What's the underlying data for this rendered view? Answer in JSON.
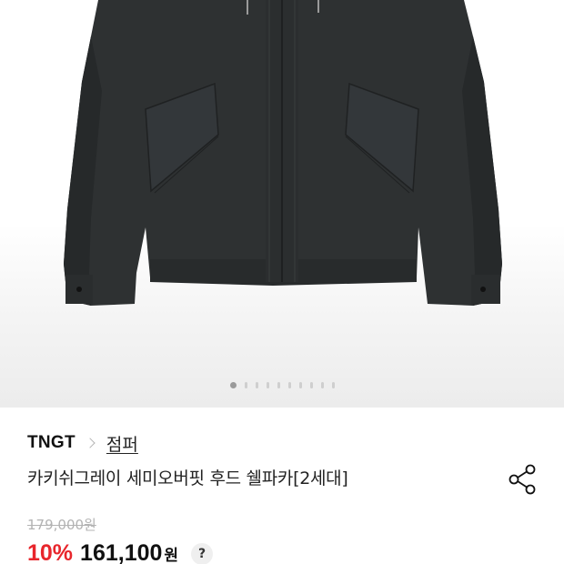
{
  "gallery": {
    "image_alt": "product-photo-jacket",
    "total_slides": 10,
    "active_slide": 1
  },
  "product": {
    "brand": "TNGT",
    "category": "점퍼",
    "title": "카키쉬그레이 세미오버핏 후드 쉘파카[2세대]",
    "original_price": "179,000원",
    "discount": "10%",
    "sale_price": "161,100",
    "currency": "원",
    "help_label": "?"
  },
  "icons": {
    "share": "share-icon",
    "breadcrumb_separator": "chevron-right-icon"
  },
  "colors": {
    "discount": "#e8262c",
    "jacket": "#2e3132"
  }
}
